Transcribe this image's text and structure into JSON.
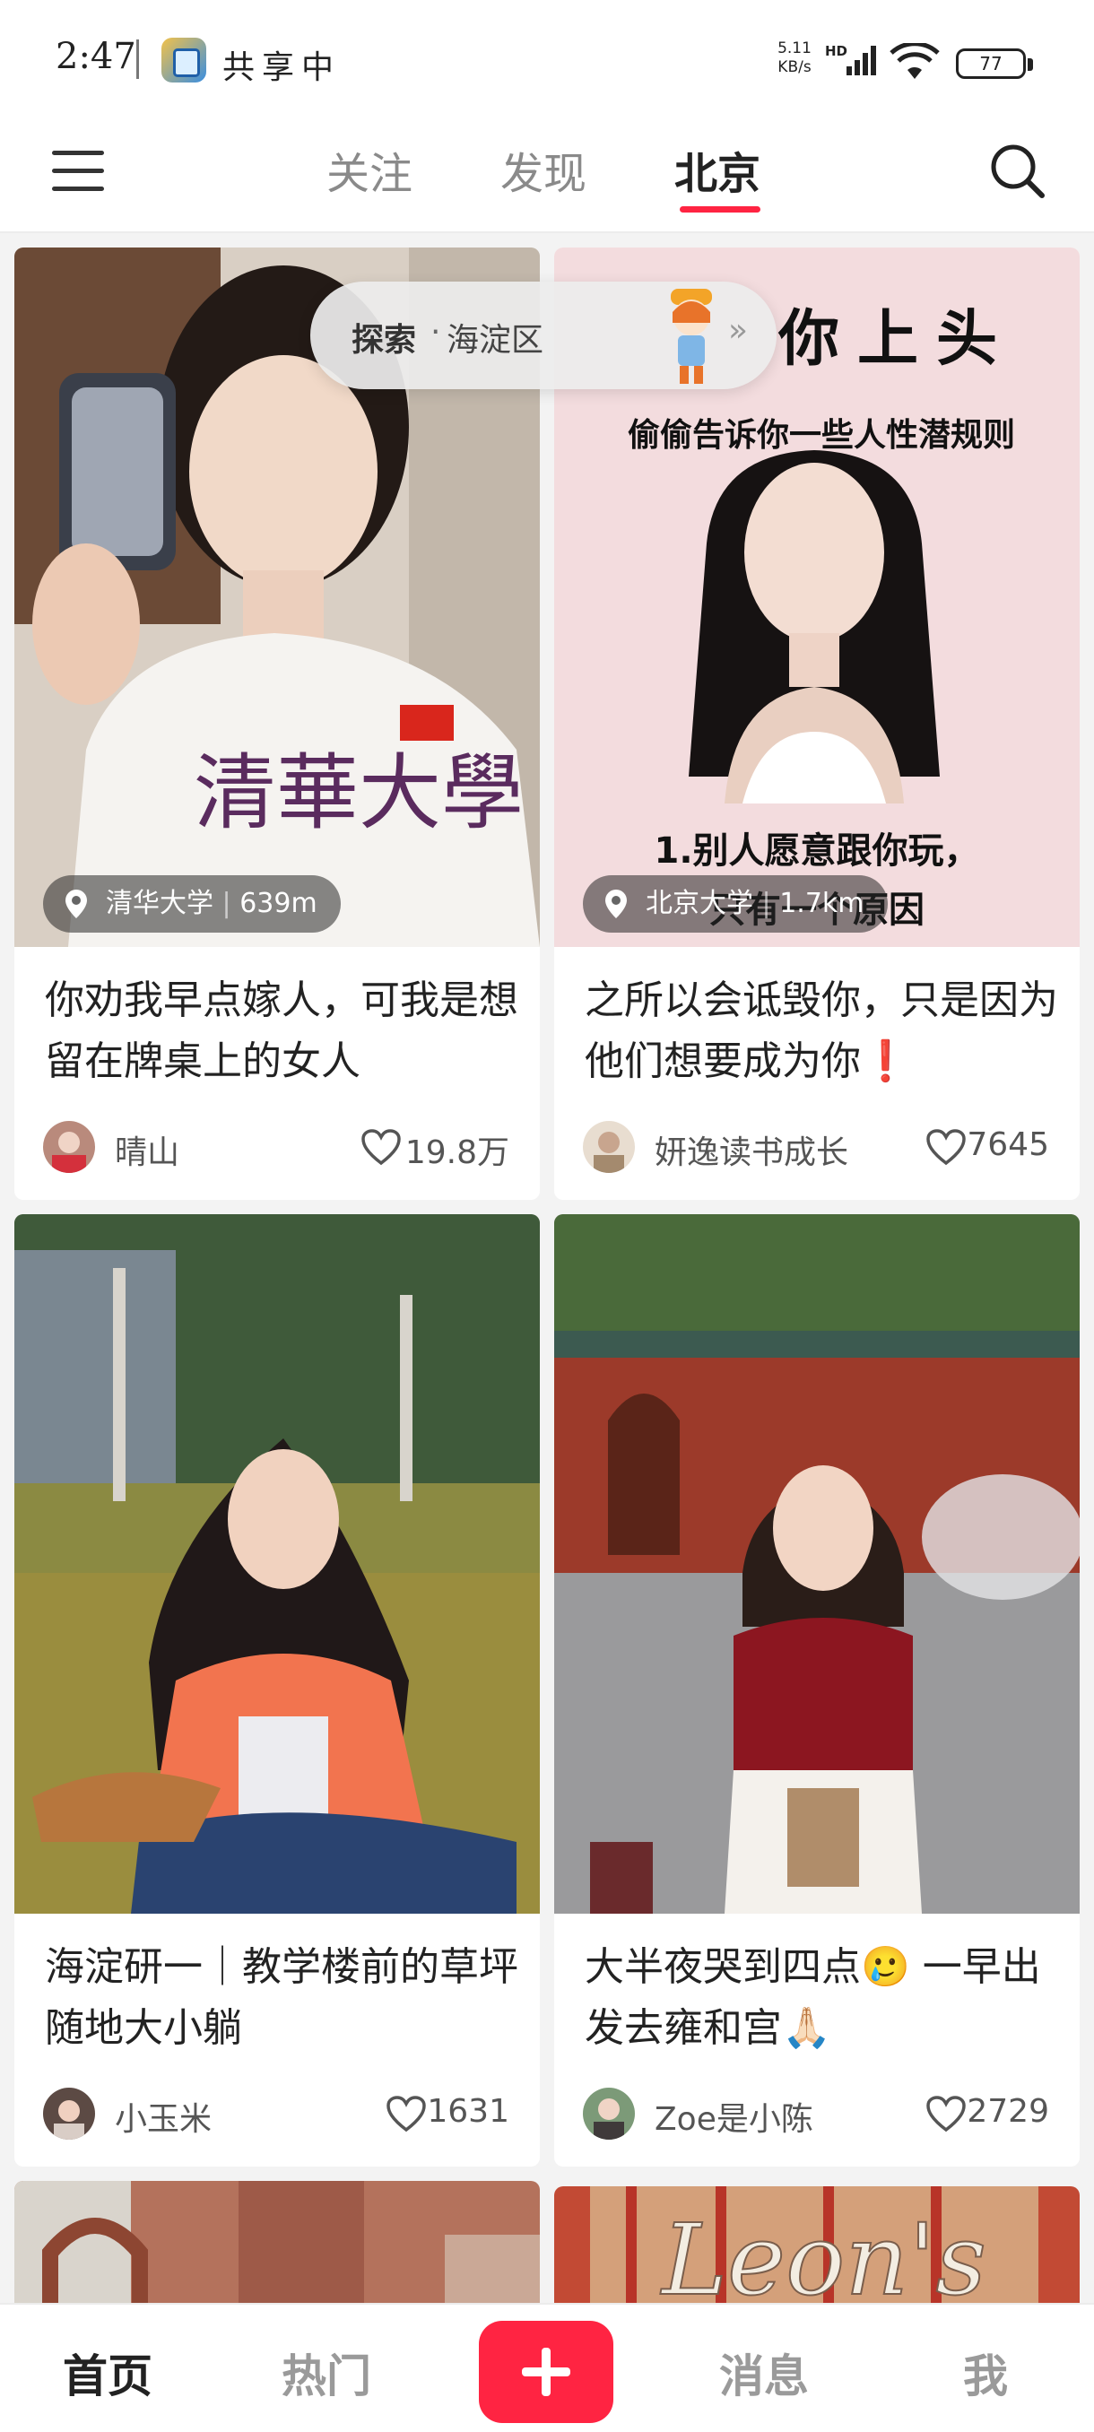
{
  "status_bar": {
    "time": "2:47",
    "sharing_text": "共享中",
    "net_speed_value": "5.11",
    "net_speed_unit": "KB/s",
    "network_label": "HD",
    "battery": "77"
  },
  "top_nav": {
    "tabs": [
      {
        "label": "关注",
        "active": false
      },
      {
        "label": "发现",
        "active": false
      },
      {
        "label": "北京",
        "active": true
      }
    ],
    "accent_color": "#ff2442"
  },
  "explore_pill": {
    "label": "探索",
    "separator": "·",
    "district": "海淀区"
  },
  "feed": {
    "cards": [
      {
        "location": "清华大学",
        "distance": "639m",
        "title": "你劝我早点嫁人，可我是想留在牌桌上的女人",
        "author": "晴山",
        "likes": "19.8万"
      },
      {
        "location": "北京大学",
        "distance": "1.7km",
        "poster_head": "你上头",
        "poster_sub": "偷偷告诉你一些人性潜规则",
        "poster_line1": "1.别人愿意跟你玩，",
        "poster_line2": "只有一个原因",
        "title": "之所以会诋毁你，只是因为他们想要成为你❗",
        "author": "妍逸读书成长",
        "likes": "7645"
      },
      {
        "title": "海淀研一｜教学楼前的草坪随地大小躺",
        "author": "小玉米",
        "likes": "1631"
      },
      {
        "title": "大半夜哭到四点🥲 一早出发去雍和宫🙏🏻",
        "author": "Zoe是小陈",
        "likes": "2729"
      },
      {
        "sign_text": "Leon's"
      }
    ]
  },
  "bottom_nav": {
    "items": [
      {
        "label": "首页",
        "active": true
      },
      {
        "label": "热门",
        "active": false
      },
      {
        "label": "消息",
        "active": false
      },
      {
        "label": "我",
        "active": false
      }
    ],
    "plus_color": "#ff2442"
  }
}
